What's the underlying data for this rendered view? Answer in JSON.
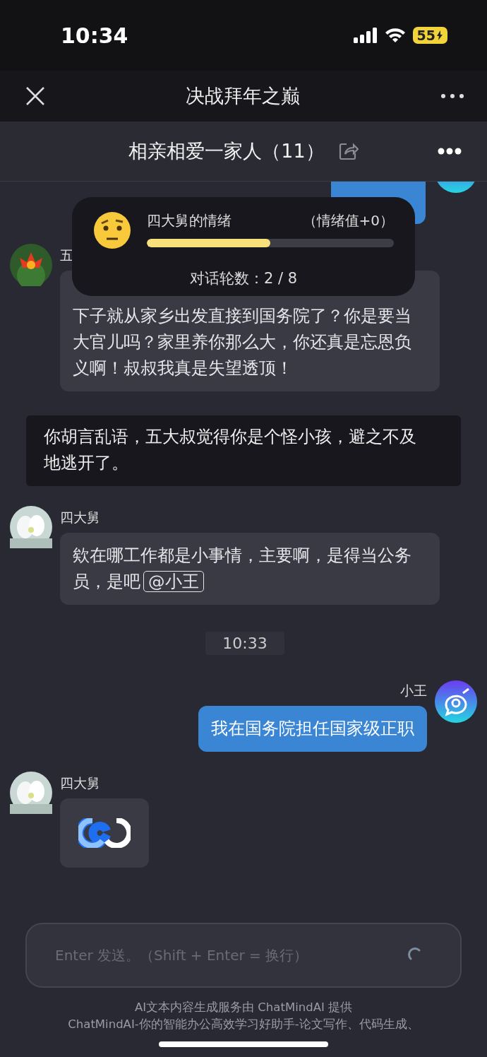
{
  "status_bar": {
    "time": "10:34",
    "battery": "55"
  },
  "nav": {
    "title": "决战拜年之巅"
  },
  "group": {
    "title": "相亲相爱一家人（11）"
  },
  "messages": [
    {
      "kind": "outgoing_cut"
    },
    {
      "kind": "incoming",
      "sender": "五",
      "text": "下子就从家乡出发直接到国务院了？你是要当大官儿吗？家里养你那么大，你还真是忘恩负义啊！叔叔我真是失望透顶！",
      "top_covered": true
    },
    {
      "kind": "narration",
      "text": "你胡言乱语，五大叔觉得你是个怪小孩，避之不及地逃开了。"
    },
    {
      "kind": "incoming",
      "sender": "四大舅",
      "text": "欸在哪工作都是小事情，主要啊，是得当公务员，是吧",
      "mention": "@小王"
    },
    {
      "kind": "timestamp",
      "text": "10:33"
    },
    {
      "kind": "outgoing",
      "sender": "小王",
      "text": "我在国务院担任国家级正职"
    },
    {
      "kind": "sticker",
      "sender": "四大舅"
    }
  ],
  "mood": {
    "title": "四大舅的情绪",
    "value": "（情绪值+0）",
    "level": 0.5,
    "rounds": "对话轮数：2 / 8"
  },
  "input": {
    "placeholder": "Enter 发送。（Shift + Enter = 换行）"
  },
  "footer": [
    "AI文本内容生成服务由 ChatMindAI 提供",
    "ChatMindAI-你的智能办公高效学习好助手-论文写作、代码生成、"
  ]
}
